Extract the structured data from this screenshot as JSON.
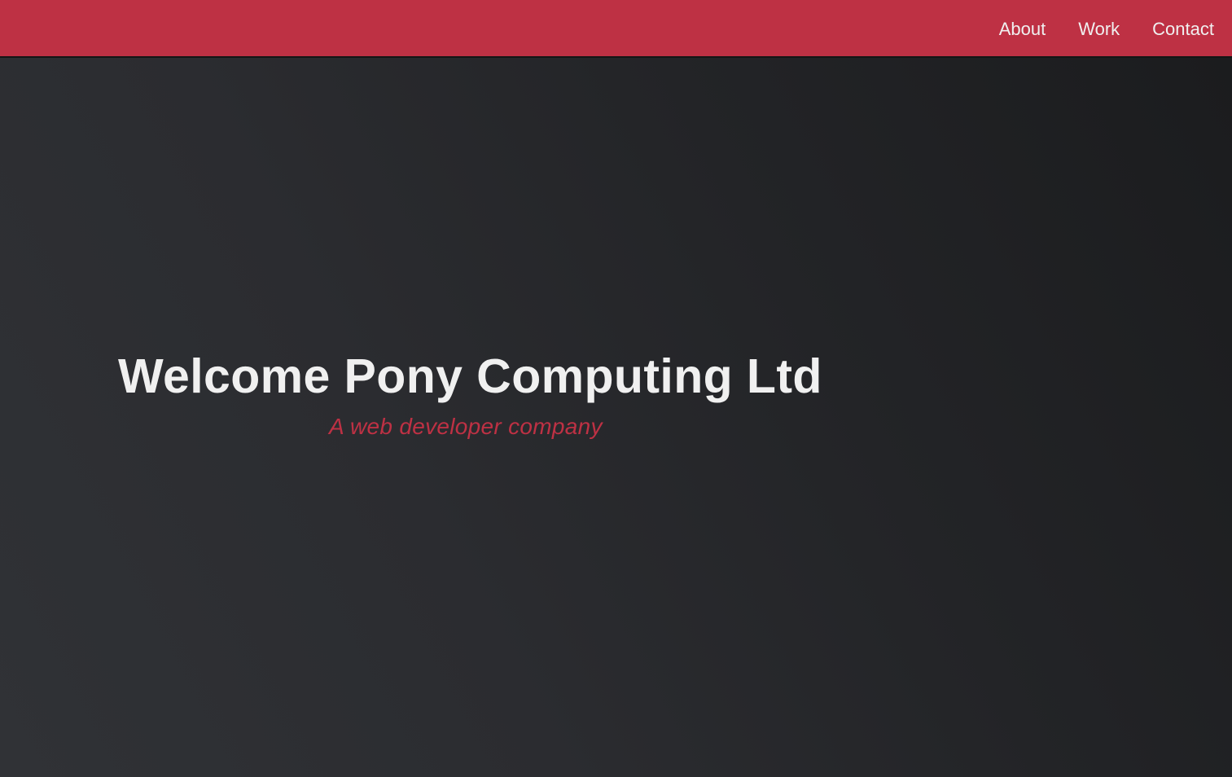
{
  "nav": {
    "items": [
      {
        "label": "About"
      },
      {
        "label": "Work"
      },
      {
        "label": "Contact"
      }
    ]
  },
  "hero": {
    "title": "Welcome Pony Computing Ltd",
    "subtitle": "A web developer company"
  },
  "colors": {
    "accent": "#be3144",
    "text_light": "#f0f0f0",
    "background_dark": "#2b2c30"
  }
}
